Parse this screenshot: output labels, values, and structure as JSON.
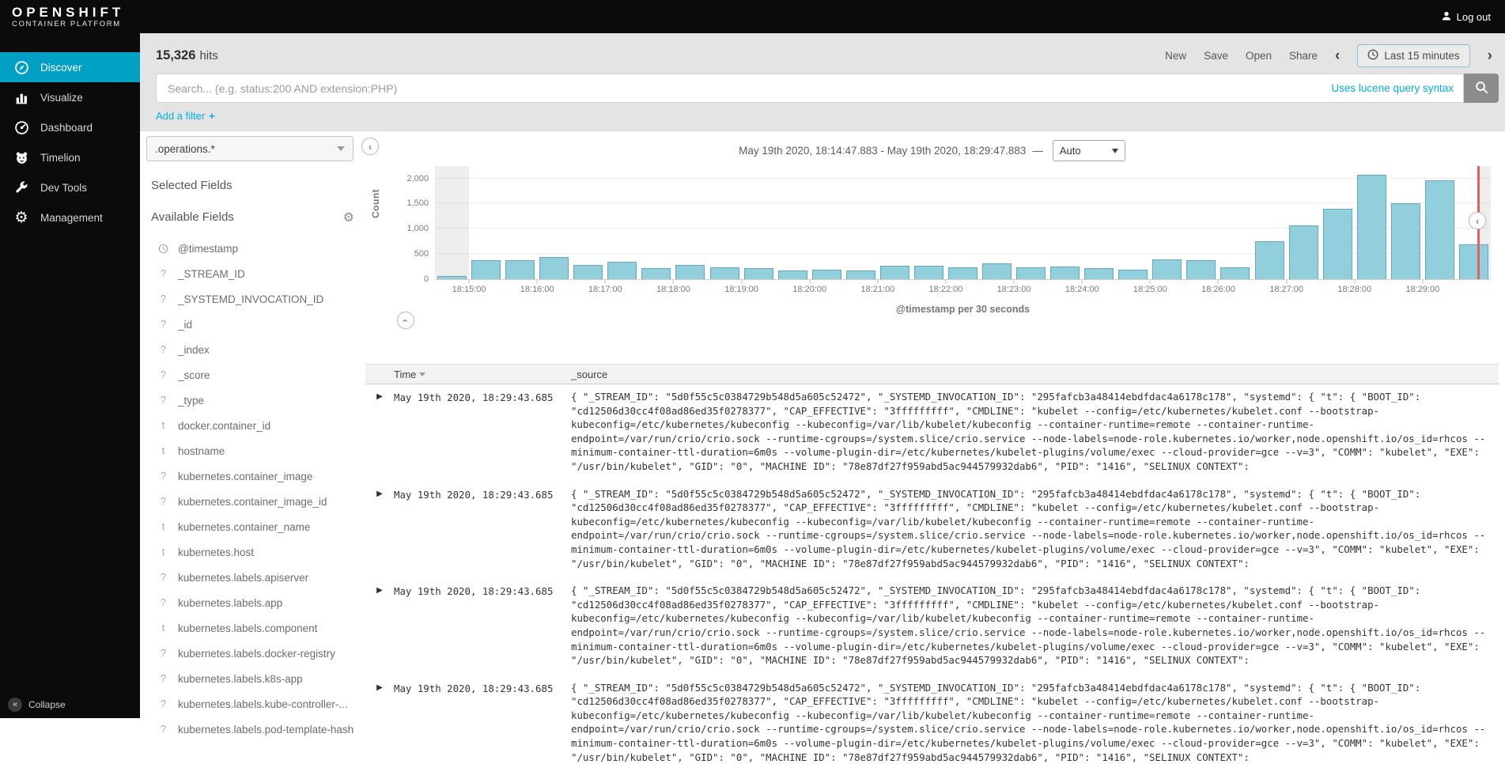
{
  "topbar": {
    "logo_line1": "OPENSHIFT",
    "logo_line2": "CONTAINER PLATFORM",
    "logout_label": "Log out"
  },
  "nav": {
    "items": [
      {
        "label": "Discover",
        "icon": "compass-icon",
        "active": true
      },
      {
        "label": "Visualize",
        "icon": "barchart-icon",
        "active": false
      },
      {
        "label": "Dashboard",
        "icon": "dashboard-icon",
        "active": false
      },
      {
        "label": "Timelion",
        "icon": "timelion-icon",
        "active": false
      },
      {
        "label": "Dev Tools",
        "icon": "wrench-icon",
        "active": false
      },
      {
        "label": "Management",
        "icon": "gear-icon",
        "active": false
      }
    ],
    "collapse_label": "Collapse"
  },
  "toolbar": {
    "hits_count": "15,326",
    "hits_label": "hits",
    "actions": [
      "New",
      "Save",
      "Open",
      "Share"
    ],
    "prev_arrow": "‹",
    "time_range_label": "Last 15 minutes",
    "next_arrow": "›"
  },
  "search": {
    "placeholder": "Search... (e.g. status:200 AND extension:PHP)",
    "syntax_link": "Uses lucene query syntax"
  },
  "filter": {
    "add_filter_label": "Add a filter",
    "plus_icon": "+"
  },
  "sidebar": {
    "index_pattern": ".operations.*",
    "selected_fields_title": "Selected Fields",
    "available_fields_title": "Available Fields",
    "fields": [
      {
        "type": "clock",
        "name": "@timestamp"
      },
      {
        "type": "?",
        "name": "_STREAM_ID"
      },
      {
        "type": "?",
        "name": "_SYSTEMD_INVOCATION_ID"
      },
      {
        "type": "?",
        "name": "_id"
      },
      {
        "type": "?",
        "name": "_index"
      },
      {
        "type": "?",
        "name": "_score"
      },
      {
        "type": "?",
        "name": "_type"
      },
      {
        "type": "t",
        "name": "docker.container_id"
      },
      {
        "type": "t",
        "name": "hostname"
      },
      {
        "type": "?",
        "name": "kubernetes.container_image"
      },
      {
        "type": "?",
        "name": "kubernetes.container_image_id"
      },
      {
        "type": "t",
        "name": "kubernetes.container_name"
      },
      {
        "type": "t",
        "name": "kubernetes.host"
      },
      {
        "type": "?",
        "name": "kubernetes.labels.apiserver"
      },
      {
        "type": "?",
        "name": "kubernetes.labels.app"
      },
      {
        "type": "t",
        "name": "kubernetes.labels.component"
      },
      {
        "type": "?",
        "name": "kubernetes.labels.docker-registry"
      },
      {
        "type": "?",
        "name": "kubernetes.labels.k8s-app"
      },
      {
        "type": "?",
        "name": "kubernetes.labels.kube-controller-..."
      },
      {
        "type": "?",
        "name": "kubernetes.labels.pod-template-hash"
      }
    ]
  },
  "chart_header": {
    "time_range": "May 19th 2020, 18:14:47.883 - May 19th 2020, 18:29:47.883",
    "separator": "—",
    "interval_value": "Auto"
  },
  "chart_data": {
    "type": "bar",
    "title": "",
    "xlabel": "@timestamp per 30 seconds",
    "ylabel": "Count",
    "ylim": [
      0,
      2150
    ],
    "y_ticks": [
      0,
      500,
      1000,
      1500,
      2000
    ],
    "y_tick_labels": [
      "0",
      "500",
      "1,000",
      "1,500",
      "2,000"
    ],
    "x_tick_labels": [
      "18:15:00",
      "18:16:00",
      "18:17:00",
      "18:18:00",
      "18:19:00",
      "18:20:00",
      "18:21:00",
      "18:22:00",
      "18:23:00",
      "18:24:00",
      "18:25:00",
      "18:26:00",
      "18:27:00",
      "18:28:00",
      "18:29:00"
    ],
    "interval_seconds": 30,
    "categories": [
      "18:14:30",
      "18:15:00",
      "18:15:30",
      "18:16:00",
      "18:16:30",
      "18:17:00",
      "18:17:30",
      "18:18:00",
      "18:18:30",
      "18:19:00",
      "18:19:30",
      "18:20:00",
      "18:20:30",
      "18:21:00",
      "18:21:30",
      "18:22:00",
      "18:22:30",
      "18:23:00",
      "18:23:30",
      "18:24:00",
      "18:24:30",
      "18:25:00",
      "18:25:30",
      "18:26:00",
      "18:26:30",
      "18:27:00",
      "18:27:30",
      "18:28:00",
      "18:28:30",
      "18:29:00",
      "18:29:30"
    ],
    "values": [
      60,
      380,
      370,
      440,
      290,
      340,
      225,
      280,
      240,
      215,
      175,
      195,
      175,
      270,
      270,
      240,
      310,
      240,
      250,
      215,
      190,
      400,
      375,
      240,
      750,
      1075,
      1400,
      2070,
      1505,
      1960,
      690
    ],
    "bar_color": "#92cfdc",
    "bar_border_color": "#61a9bb",
    "now_marker_color": "#e25f5f",
    "now_marker_position_fraction": 0.987,
    "grid": true,
    "legend": "none"
  },
  "table": {
    "columns": [
      {
        "label": "Time",
        "sorted": "desc"
      },
      {
        "label": "_source",
        "sorted": "none"
      }
    ],
    "rows": [
      {
        "time": "May 19th 2020, 18:29:43.685"
      },
      {
        "time": "May 19th 2020, 18:29:43.685"
      },
      {
        "time": "May 19th 2020, 18:29:43.685"
      },
      {
        "time": "May 19th 2020, 18:29:43.685"
      }
    ],
    "source_all_rows": "{ \"_STREAM_ID\": \"5d0f55c5c0384729b548d5a605c52472\", \"_SYSTEMD_INVOCATION_ID\": \"295fafcb3a48414ebdfdac4a6178c178\", \"systemd\": { \"t\": { \"BOOT_ID\": \"cd12506d30cc4f08ad86ed35f0278377\", \"CAP_EFFECTIVE\": \"3fffffffff\", \"CMDLINE\": \"kubelet --config=/etc/kubernetes/kubelet.conf --bootstrap-kubeconfig=/etc/kubernetes/kubeconfig --kubeconfig=/var/lib/kubelet/kubeconfig --container-runtime=remote --container-runtime-endpoint=/var/run/crio/crio.sock --runtime-cgroups=/system.slice/crio.service --node-labels=node-role.kubernetes.io/worker,node.openshift.io/os_id=rhcos --minimum-container-ttl-duration=6m0s --volume-plugin-dir=/etc/kubernetes/kubelet-plugins/volume/exec --cloud-provider=gce --v=3\", \"COMM\": \"kubelet\", \"EXE\": \"/usr/bin/kubelet\", \"GID\": \"0\", \"MACHINE ID\": \"78e87df27f959abd5ac944579932dab6\", \"PID\": \"1416\", \"SELINUX CONTEXT\":"
  },
  "colors": {
    "accent_active_nav": "#00a0c5",
    "link": "#00b1dc",
    "bar_fill": "#92cfdc",
    "bar_stroke": "#61a9bb",
    "now_marker": "#e25f5f",
    "topbar_bg": "#0b0b0b",
    "band_bg": "#e4e4e4"
  }
}
